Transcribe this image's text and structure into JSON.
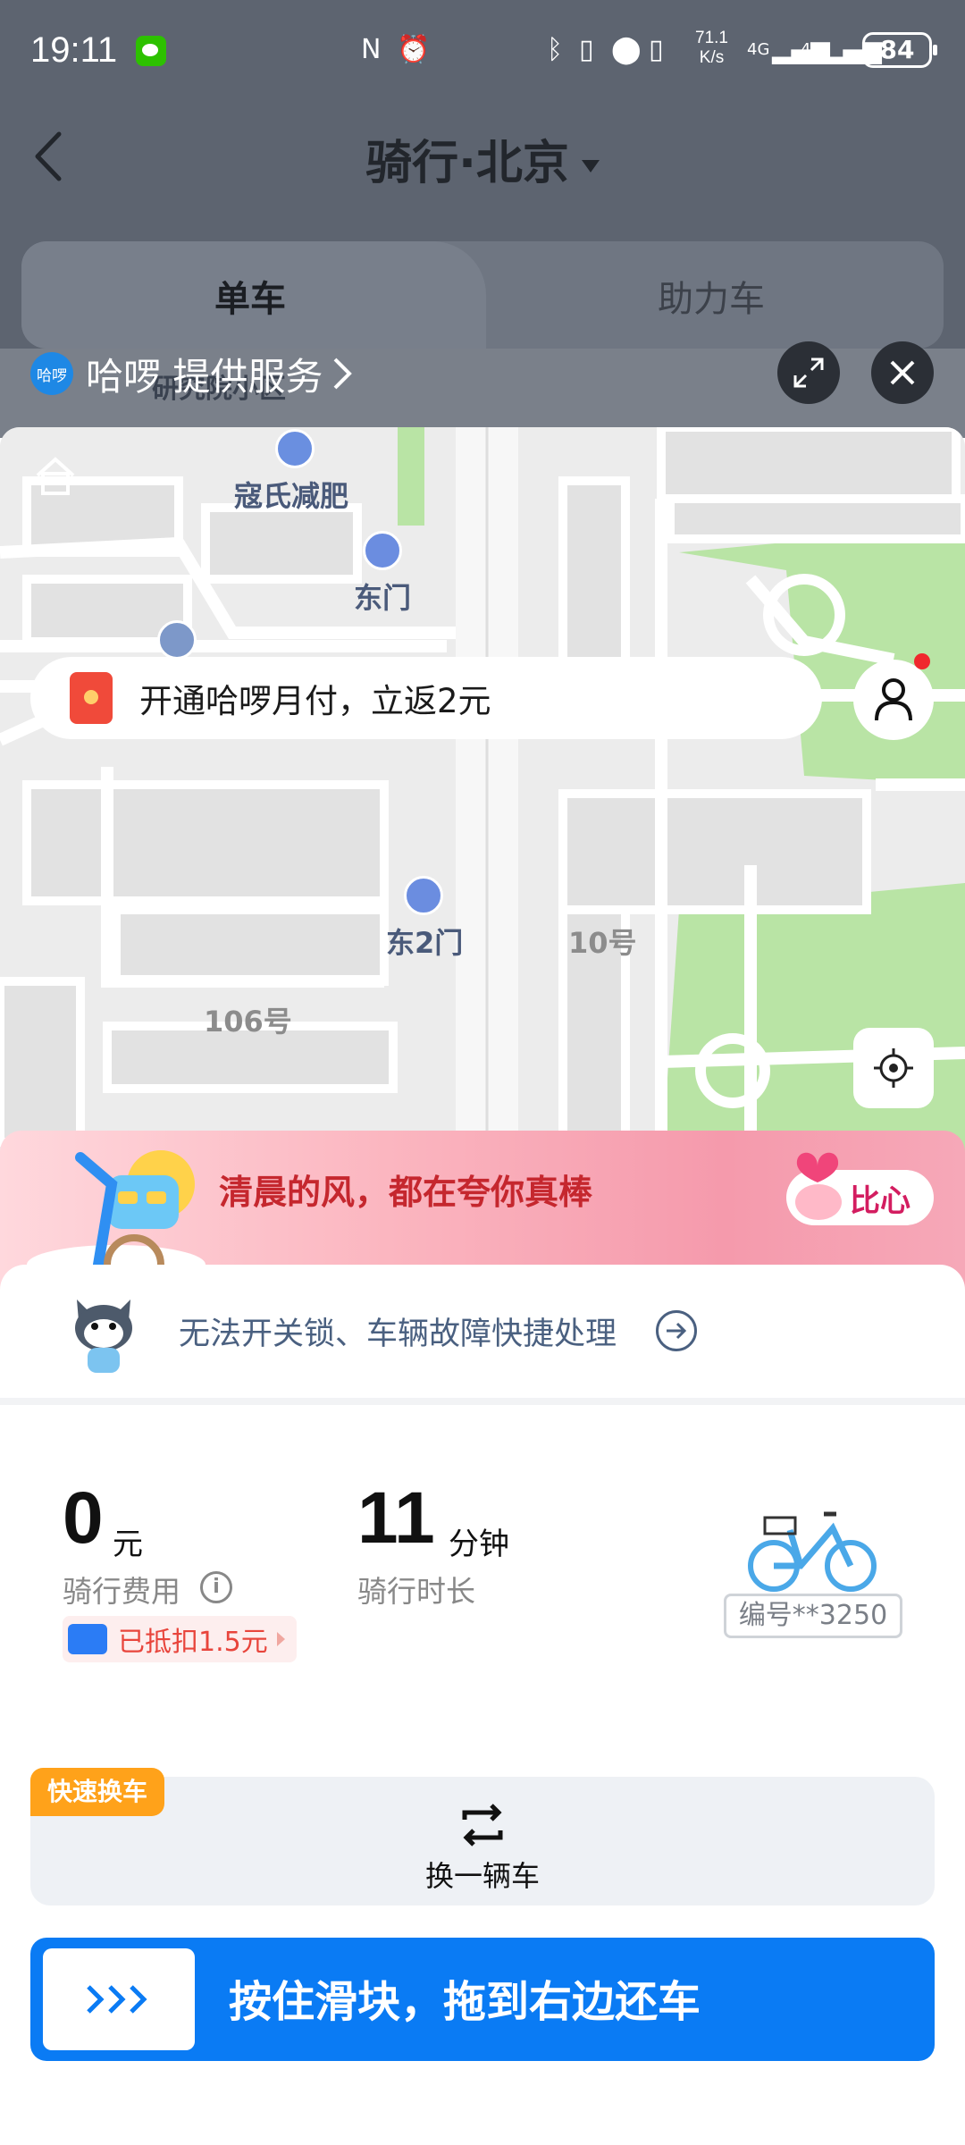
{
  "status": {
    "time": "19:11",
    "net_speed_line1": "71.1",
    "net_speed_line2": "K/s",
    "signal1": "4G",
    "signal2": "4G",
    "battery": "84"
  },
  "nav": {
    "title": "骑行·北京"
  },
  "tabs": [
    {
      "label": "单车",
      "active": true
    },
    {
      "label": "助力车",
      "active": false
    }
  ],
  "provider": {
    "logo_text": "哈啰",
    "label": "哈啰 提供服务"
  },
  "map": {
    "pois": [
      {
        "name": "研究院小区"
      },
      {
        "name": "寇氏减肥"
      },
      {
        "name": "东门"
      },
      {
        "name": "东2门"
      },
      {
        "name": "10号"
      },
      {
        "name": "106号"
      }
    ]
  },
  "promo": {
    "text": "开通哈啰月付，立返2元"
  },
  "banner": {
    "text": "清晨的风，都在夸你真棒",
    "button": "比心"
  },
  "help": {
    "text": "无法开关锁、车辆故障快捷处理"
  },
  "ride": {
    "fee_value": "0",
    "fee_unit": "元",
    "fee_label": "骑行费用",
    "deduct_text": "已抵扣1.5元",
    "duration_value": "11",
    "duration_unit": "分钟",
    "duration_label": "骑行时长",
    "bike_no": "编号**3250"
  },
  "swap": {
    "tag": "快速换车",
    "label": "换一辆车"
  },
  "slider": {
    "label": "按住滑块，拖到右边还车",
    "knob": ">>>"
  },
  "colors": {
    "primary": "#0a7bf4",
    "tag_orange": "#ffa21a",
    "deduct_red": "#e8453c",
    "park_green": "#b9e4a5"
  }
}
